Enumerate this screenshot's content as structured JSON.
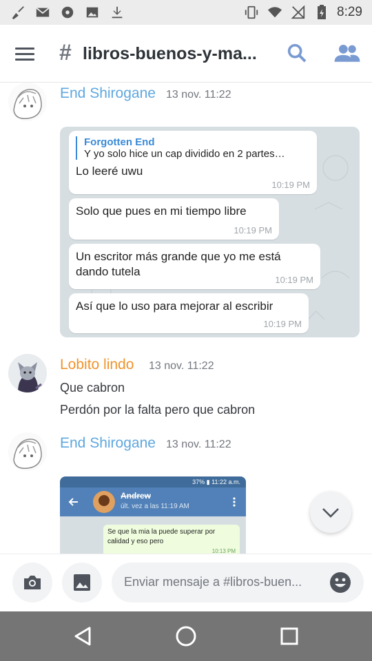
{
  "status_bar": {
    "time": "8:29"
  },
  "header": {
    "hash": "#",
    "channel_name": "libros-buenos-y-ma..."
  },
  "messages": [
    {
      "author": "End Shirogane",
      "timestamp": "13 nov. 11:22",
      "author_color": "#5fa7de"
    },
    {
      "author": "Lobito lindo",
      "timestamp": "13 nov. 11:22",
      "author_color": "#f0932b",
      "lines": [
        "Que cabron",
        "Perdón por la falta pero que cabron"
      ]
    },
    {
      "author": "End Shirogane",
      "timestamp": "13 nov. 11:22",
      "author_color": "#5fa7de"
    }
  ],
  "screenshot1": {
    "quote_name": "Forgotten End",
    "quote_text": "Y yo solo hice un cap dividido en 2 partes…",
    "bubbles": [
      {
        "text": "Lo leeré uwu",
        "time": "10:19 PM"
      },
      {
        "text": "Solo que pues en mi tiempo libre",
        "time": "10:19 PM"
      },
      {
        "text": "Un escritor más grande que yo me está\ndando tutela",
        "time": "10:19 PM"
      },
      {
        "text": "Así que lo uso para mejorar al escribir",
        "time": "10:19 PM"
      }
    ]
  },
  "screenshot2": {
    "status": "37% ▮ 11:22 a.m.",
    "contact_name": "Andrew",
    "last_seen": "últ. vez a las 11:19 AM",
    "bubble_text": "Se que la mia la puede superar por calidad y eso pero",
    "bubble_time": "10:13 PM"
  },
  "composer": {
    "placeholder": "Enviar mensaje a #libros-buen..."
  },
  "colors": {
    "accent": "#5fa7de",
    "orange": "#f0932b",
    "background": "#ffffff",
    "navbar": "#757575"
  }
}
